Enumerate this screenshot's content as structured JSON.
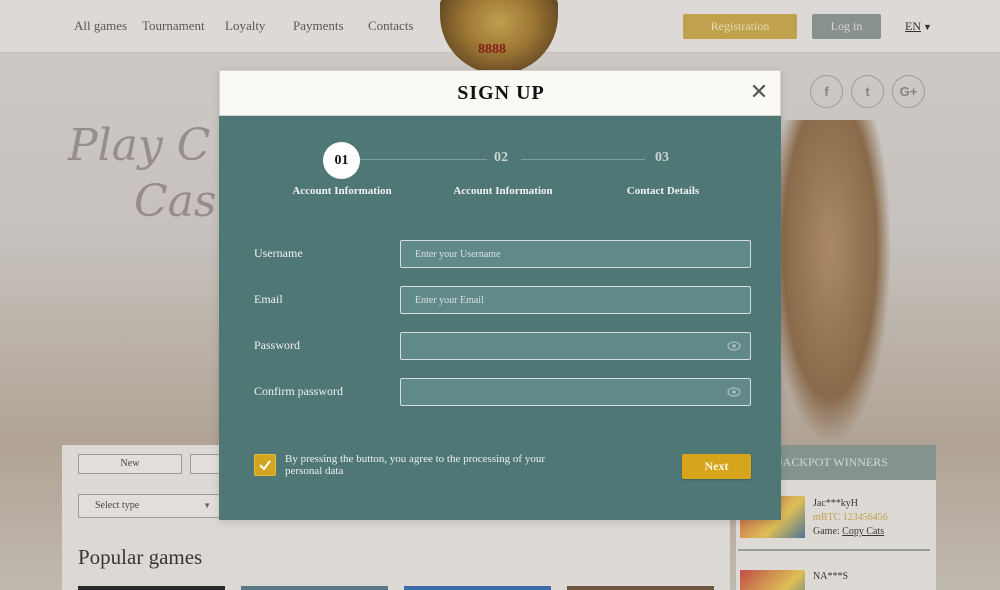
{
  "header": {
    "nav": [
      "All games",
      "Tournament",
      "Loyalty",
      "Payments",
      "Contacts"
    ],
    "registration_label": "Registration",
    "login_label": "Log in",
    "language": "EN",
    "logo_text": "8888"
  },
  "hero": {
    "line1": "Play C",
    "line2": "Cas"
  },
  "social": [
    {
      "icon": "facebook-icon",
      "glyph": "f"
    },
    {
      "icon": "twitter-icon",
      "glyph": "t"
    },
    {
      "icon": "google-plus-icon",
      "glyph": "G+"
    }
  ],
  "games": {
    "filter_new": "New",
    "select_placeholder": "Select type",
    "popular_title": "Popular games"
  },
  "winners": {
    "title": "JACKPOT WINNERS",
    "items": [
      {
        "name": "Jac***kyH",
        "amount": "mBTC 123456456",
        "game_prefix": "Game:",
        "game": "Copy Cats"
      },
      {
        "name": "NA***S"
      }
    ]
  },
  "modal": {
    "title": "SIGN UP",
    "close_glyph": "✕",
    "steps": [
      {
        "num": "01",
        "label": "Account Information",
        "active": true
      },
      {
        "num": "02",
        "label": "Account Information",
        "active": false
      },
      {
        "num": "03",
        "label": "Contact Details",
        "active": false
      }
    ],
    "fields": [
      {
        "label": "Username",
        "placeholder": "Enter your Username",
        "value": ""
      },
      {
        "label": "Email",
        "placeholder": "Enter your Email",
        "value": ""
      },
      {
        "label": "Password",
        "placeholder": "",
        "value": ""
      },
      {
        "label": "Confirm password",
        "placeholder": "",
        "value": ""
      }
    ],
    "agree_text": "By pressing the button, you agree to the processing of your personal data",
    "agree_checked": true,
    "next_label": "Next"
  },
  "colors": {
    "modal_bg": "#4f7775",
    "accent": "#d6a51b",
    "header_bg": "#fbf9f6"
  }
}
